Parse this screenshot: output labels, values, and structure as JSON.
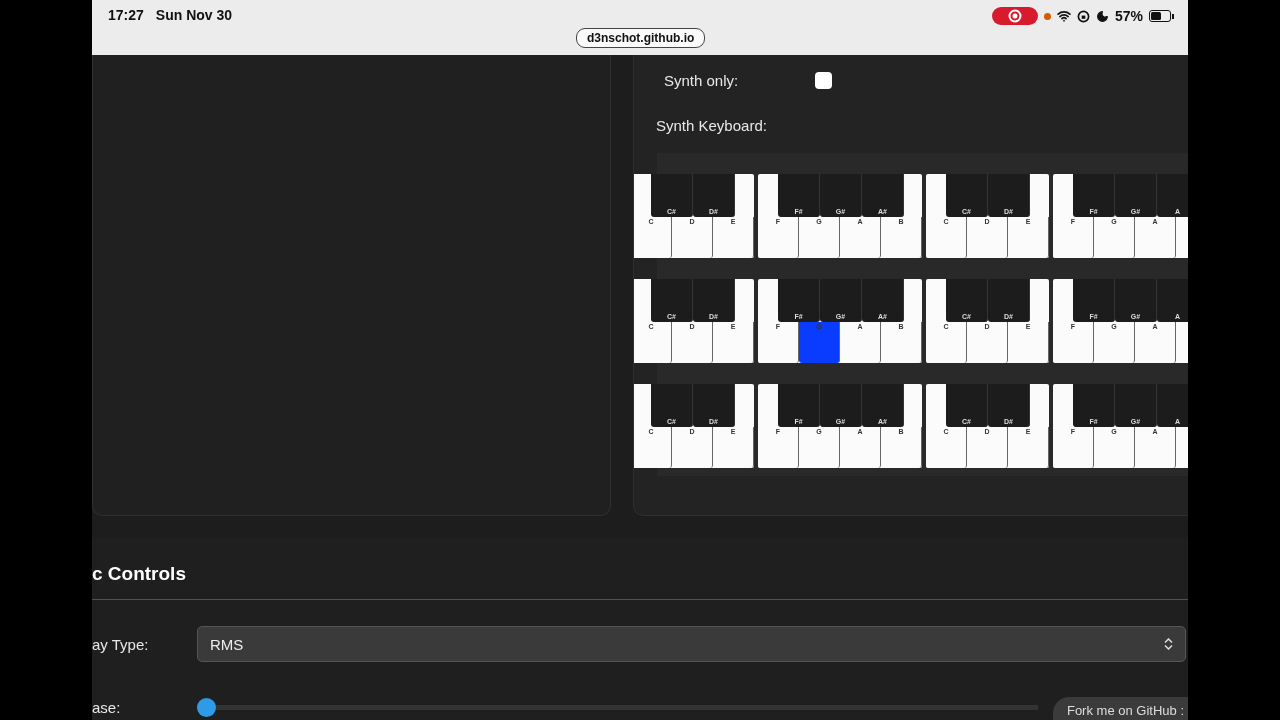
{
  "status_bar": {
    "time": "17:27",
    "date": "Sun Nov 30",
    "url": "d3nschot.github.io",
    "recording": true,
    "battery_text": "57%",
    "battery": {
      "level": 0.57
    }
  },
  "synth_panel": {
    "synth_only": {
      "label": "Synth only:",
      "checked": false
    },
    "keyboard_label": "Synth Keyboard:",
    "keyboard_rows": [
      {
        "octaves": [
          {
            "whites": [
              {
                "label": "C",
                "pressed": false
              },
              {
                "label": "D",
                "pressed": false
              },
              {
                "label": "E",
                "pressed": false
              }
            ],
            "blacks": [
              "C#",
              "D#"
            ]
          },
          {
            "whites": [
              {
                "label": "F",
                "pressed": false
              },
              {
                "label": "G",
                "pressed": false
              },
              {
                "label": "A",
                "pressed": false
              },
              {
                "label": "B",
                "pressed": false
              }
            ],
            "blacks": [
              "F#",
              "G#",
              "A#"
            ]
          },
          {
            "whites": [
              {
                "label": "C",
                "pressed": false
              },
              {
                "label": "D",
                "pressed": false
              },
              {
                "label": "E",
                "pressed": false
              }
            ],
            "blacks": [
              "C#",
              "D#"
            ]
          },
          {
            "whites": [
              {
                "label": "F",
                "pressed": false
              },
              {
                "label": "G",
                "pressed": false
              },
              {
                "label": "A",
                "pressed": false
              }
            ],
            "blacks": [
              "F#",
              "G#",
              "A"
            ]
          }
        ]
      },
      {
        "octaves": [
          {
            "whites": [
              {
                "label": "C",
                "pressed": false
              },
              {
                "label": "D",
                "pressed": false
              },
              {
                "label": "E",
                "pressed": false
              }
            ],
            "blacks": [
              "C#",
              "D#"
            ]
          },
          {
            "whites": [
              {
                "label": "F",
                "pressed": false
              },
              {
                "label": "G",
                "pressed": true
              },
              {
                "label": "A",
                "pressed": false
              },
              {
                "label": "B",
                "pressed": false
              }
            ],
            "blacks": [
              "F#",
              "G#",
              "A#"
            ]
          },
          {
            "whites": [
              {
                "label": "C",
                "pressed": false
              },
              {
                "label": "D",
                "pressed": false
              },
              {
                "label": "E",
                "pressed": false
              }
            ],
            "blacks": [
              "C#",
              "D#"
            ]
          },
          {
            "whites": [
              {
                "label": "F",
                "pressed": false
              },
              {
                "label": "G",
                "pressed": false
              },
              {
                "label": "A",
                "pressed": false
              }
            ],
            "blacks": [
              "F#",
              "G#",
              "A"
            ]
          }
        ]
      },
      {
        "octaves": [
          {
            "whites": [
              {
                "label": "C",
                "pressed": false
              },
              {
                "label": "D",
                "pressed": false
              },
              {
                "label": "E",
                "pressed": false
              }
            ],
            "blacks": [
              "C#",
              "D#"
            ]
          },
          {
            "whites": [
              {
                "label": "F",
                "pressed": false
              },
              {
                "label": "G",
                "pressed": false
              },
              {
                "label": "A",
                "pressed": false
              },
              {
                "label": "B",
                "pressed": false
              }
            ],
            "blacks": [
              "F#",
              "G#",
              "A#"
            ]
          },
          {
            "whites": [
              {
                "label": "C",
                "pressed": false
              },
              {
                "label": "D",
                "pressed": false
              },
              {
                "label": "E",
                "pressed": false
              }
            ],
            "blacks": [
              "C#",
              "D#"
            ]
          },
          {
            "whites": [
              {
                "label": "F",
                "pressed": false
              },
              {
                "label": "G",
                "pressed": false
              },
              {
                "label": "A",
                "pressed": false
              }
            ],
            "blacks": [
              "F#",
              "G#",
              "A"
            ]
          }
        ]
      }
    ]
  },
  "controls": {
    "title": "c Controls",
    "type_label": "ay Type:",
    "type_value": "RMS",
    "release_label": "ase:",
    "release": {
      "level": 0.0
    }
  },
  "github_ribbon": "Fork me on GitHub :"
}
